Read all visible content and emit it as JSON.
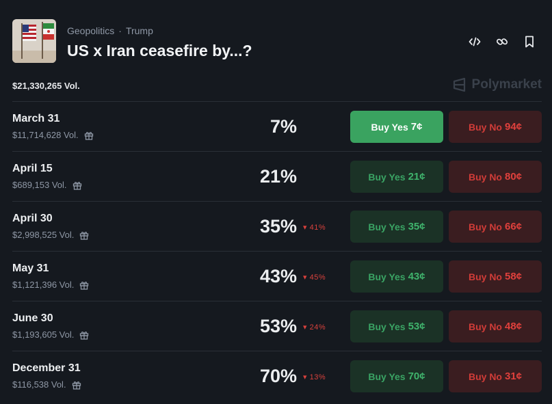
{
  "market": {
    "category": "Geopolitics",
    "separator": "·",
    "tag": "Trump",
    "title": "US x Iran ceasefire by...?",
    "total_volume": "$21,330,265 Vol.",
    "brand": "Polymarket"
  },
  "icons": {
    "embed": "code-icon",
    "link": "link-icon",
    "bookmark": "bookmark-icon",
    "gift": "gift-icon"
  },
  "colors": {
    "background": "#15191f",
    "yes_active": "#3aa360",
    "yes": "#1b3226",
    "no": "#3a1d20",
    "down": "#d9413c"
  },
  "outcomes": [
    {
      "date": "March 31",
      "volume": "$11,714,628 Vol.",
      "pct": "7%",
      "change": "",
      "yes_label": "Buy Yes",
      "yes_price": "7¢",
      "no_label": "Buy No",
      "no_price": "94¢"
    },
    {
      "date": "April 15",
      "volume": "$689,153 Vol.",
      "pct": "21%",
      "change": "",
      "yes_label": "Buy Yes",
      "yes_price": "21¢",
      "no_label": "Buy No",
      "no_price": "80¢"
    },
    {
      "date": "April 30",
      "volume": "$2,998,525 Vol.",
      "pct": "35%",
      "change": "▾ 41%",
      "yes_label": "Buy Yes",
      "yes_price": "35¢",
      "no_label": "Buy No",
      "no_price": "66¢"
    },
    {
      "date": "May 31",
      "volume": "$1,121,396 Vol.",
      "pct": "43%",
      "change": "▾ 45%",
      "yes_label": "Buy Yes",
      "yes_price": "43¢",
      "no_label": "Buy No",
      "no_price": "58¢"
    },
    {
      "date": "June 30",
      "volume": "$1,193,605 Vol.",
      "pct": "53%",
      "change": "▾ 24%",
      "yes_label": "Buy Yes",
      "yes_price": "53¢",
      "no_label": "Buy No",
      "no_price": "48¢"
    },
    {
      "date": "December 31",
      "volume": "$116,538 Vol.",
      "pct": "70%",
      "change": "▾ 13%",
      "yes_label": "Buy Yes",
      "yes_price": "70¢",
      "no_label": "Buy No",
      "no_price": "31¢"
    }
  ]
}
